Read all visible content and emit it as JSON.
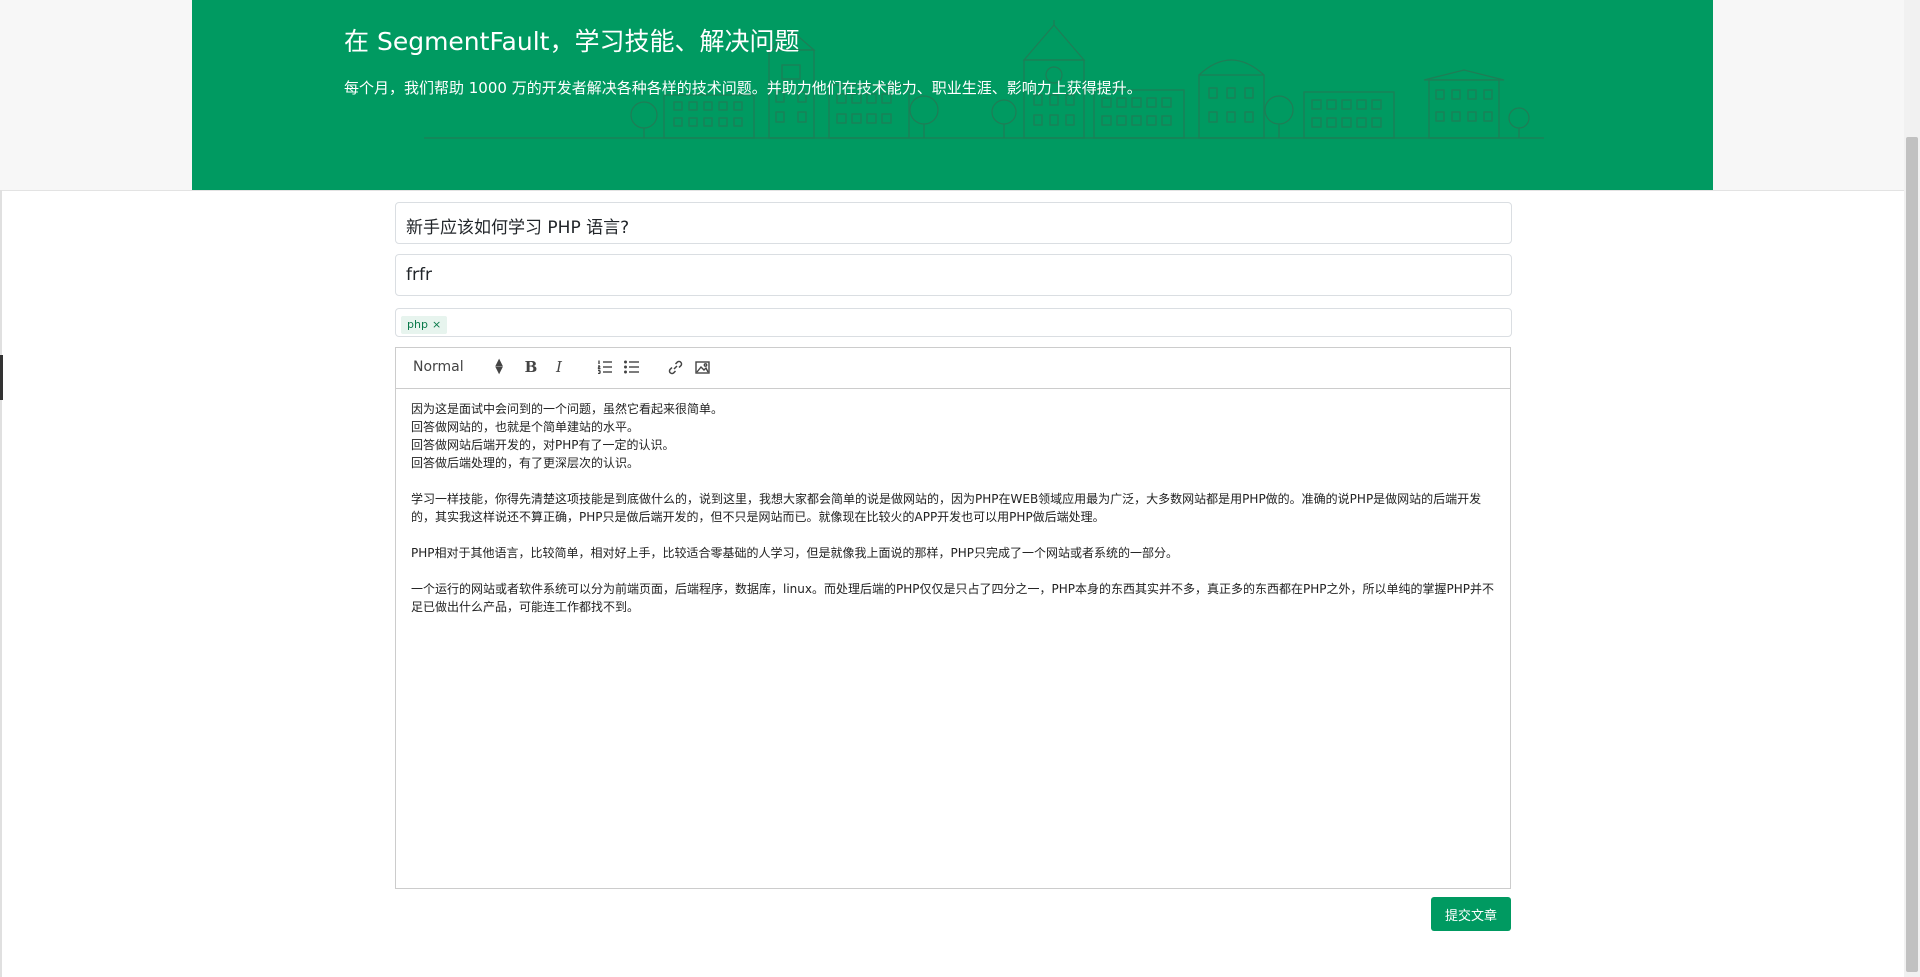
{
  "hero": {
    "title": "在 SegmentFault，学习技能、解决问题",
    "subtitle": "每个月，我们帮助 1000 万的开发者解决各种各样的技术问题。并助力他们在技术能力、职业生涯、影响力上获得提升。"
  },
  "form": {
    "title_value": "新手应该如何学习 PHP 语言?",
    "subtitle_value": "frfr",
    "tags": [
      {
        "label": "php",
        "remove": "×"
      }
    ]
  },
  "editor": {
    "toolbar": {
      "heading_select": "Normal",
      "bold": "B",
      "italic": "I"
    },
    "lines": [
      "因为这是面试中会问到的一个问题，虽然它看起来很简单。",
      "回答做网站的，也就是个简单建站的水平。",
      "回答做网站后端开发的，对PHP有了一定的认识。",
      "回答做后端处理的，有了更深层次的认识。",
      "",
      "学习一样技能，你得先清楚这项技能是到底做什么的，说到这里，我想大家都会简单的说是做网站的，因为PHP在WEB领域应用最为广泛，大多数网站都是用PHP做的。准确的说PHP是做网站的后端开发的，其实我这样说还不算正确，PHP只是做后端开发的，但不只是网站而已。就像现在比较火的APP开发也可以用PHP做后端处理。",
      "",
      "PHP相对于其他语言，比较简单，相对好上手，比较适合零基础的人学习，但是就像我上面说的那样，PHP只完成了一个网站或者系统的一部分。",
      "",
      "一个运行的网站或者软件系统可以分为前端页面，后端程序，数据库，linux。而处理后端的PHP仅仅是只占了四分之一，PHP本身的东西其实并不多，真正多的东西都在PHP之外，所以单纯的掌握PHP并不足已做出什么产品，可能连工作都找不到。"
    ]
  },
  "actions": {
    "submit_label": "提交文章"
  },
  "colors": {
    "brand": "#009a61",
    "tag_bg": "#e7f4ee"
  }
}
